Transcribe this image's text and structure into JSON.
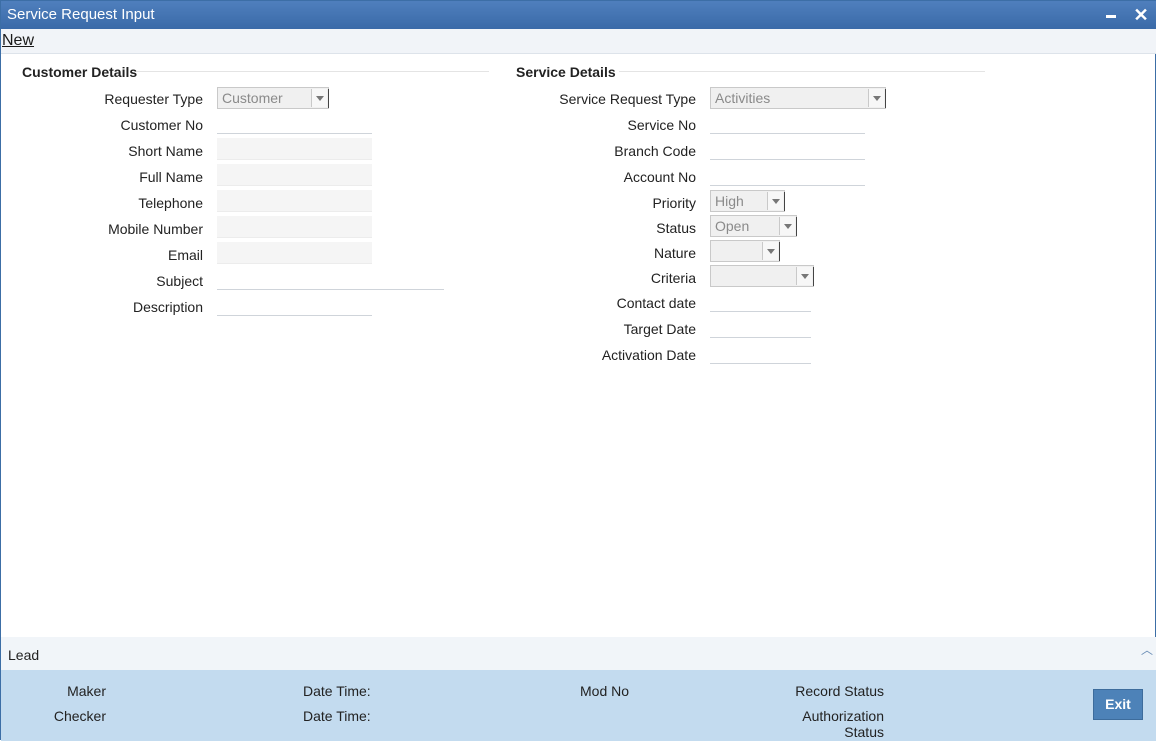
{
  "window": {
    "title": "Service Request Input"
  },
  "toolbar": {
    "new_label": "New"
  },
  "customer": {
    "section_title": "Customer Details",
    "requester_type_label": "Requester Type",
    "requester_type_value": "Customer",
    "customer_no_label": "Customer No",
    "short_name_label": "Short Name",
    "full_name_label": "Full Name",
    "telephone_label": "Telephone",
    "mobile_label": "Mobile Number",
    "email_label": "Email",
    "subject_label": "Subject",
    "description_label": "Description"
  },
  "service": {
    "section_title": "Service Details",
    "request_type_label": "Service Request Type",
    "request_type_value": "Activities",
    "service_no_label": "Service No",
    "branch_code_label": "Branch Code",
    "account_no_label": "Account No",
    "priority_label": "Priority",
    "priority_value": "High",
    "status_label": "Status",
    "status_value": "Open",
    "nature_label": "Nature",
    "nature_value": "",
    "criteria_label": "Criteria",
    "criteria_value": "",
    "contact_date_label": "Contact date",
    "target_date_label": "Target Date",
    "activation_date_label": "Activation Date"
  },
  "lead": {
    "label": "Lead"
  },
  "footer": {
    "maker": "Maker",
    "date_time_1": "Date Time:",
    "mod_no": "Mod No",
    "record_status": "Record Status",
    "checker": "Checker",
    "date_time_2": "Date Time:",
    "authorization_status_1": "Authorization",
    "authorization_status_2": "Status",
    "exit_label": "Exit"
  }
}
